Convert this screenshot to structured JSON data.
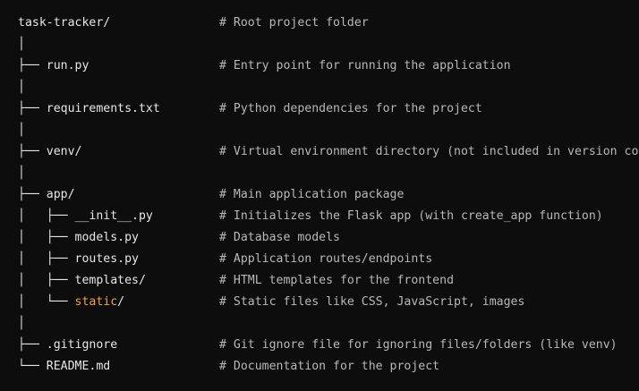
{
  "tree": {
    "lines": [
      {
        "prefix": "",
        "name": "task-tracker/",
        "comment": "# Root project folder"
      },
      {
        "prefix": "│",
        "name": "",
        "comment": ""
      },
      {
        "prefix": "├── ",
        "name": "run.py",
        "comment": "# Entry point for running the application"
      },
      {
        "prefix": "│",
        "name": "",
        "comment": ""
      },
      {
        "prefix": "├── ",
        "name": "requirements.txt",
        "comment": "# Python dependencies for the project"
      },
      {
        "prefix": "│",
        "name": "",
        "comment": ""
      },
      {
        "prefix": "├── ",
        "name": "venv/",
        "comment": "# Virtual environment directory (not included in version co"
      },
      {
        "prefix": "│",
        "name": "",
        "comment": ""
      },
      {
        "prefix": "├── ",
        "name": "app/",
        "comment": "# Main application package"
      },
      {
        "prefix": "│   ├── ",
        "name": "__init__.py",
        "comment": "# Initializes the Flask app (with create_app function)"
      },
      {
        "prefix": "│   ├── ",
        "name": "models.py",
        "comment": "# Database models"
      },
      {
        "prefix": "│   ├── ",
        "name": "routes.py",
        "comment": "# Application routes/endpoints"
      },
      {
        "prefix": "│   ├── ",
        "name": "templates/",
        "comment": "# HTML templates for the frontend"
      },
      {
        "prefix": "│   └── ",
        "name": "static/",
        "comment": "# Static files like CSS, JavaScript, images"
      },
      {
        "prefix": "│",
        "name": "",
        "comment": ""
      },
      {
        "prefix": "├── ",
        "name": ".gitignore",
        "comment": "# Git ignore file for ignoring files/folders (like venv)"
      },
      {
        "prefix": "└── ",
        "name": "README.md",
        "comment": "# Documentation for the project"
      }
    ],
    "highlight_color": "#f0a24a",
    "highlighted_segment": "static"
  }
}
